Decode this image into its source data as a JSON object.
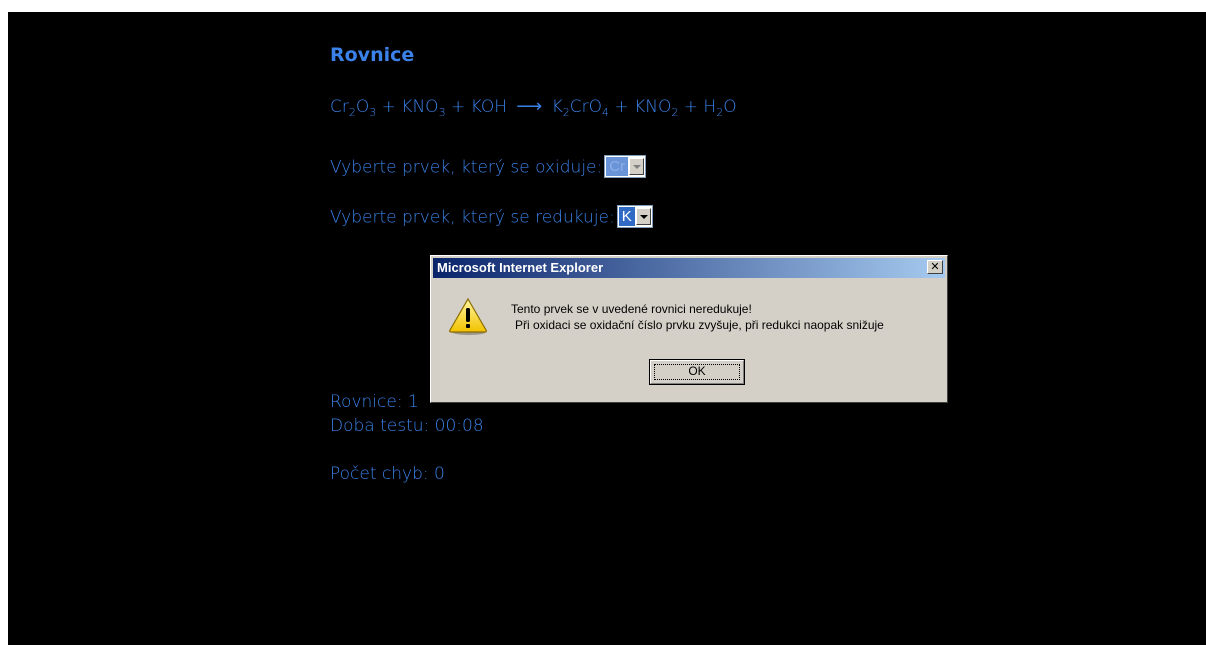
{
  "quiz": {
    "title": "Rovnice",
    "equation": {
      "arrow": "⟶"
    },
    "question_oxidizes": "Vyberte prvek, který se oxiduje:",
    "question_reduces": "Vyberte prvek, který se redukuje:",
    "oxidizes_selected": "Cr",
    "reduces_selected": "K",
    "equation_counter": "Rovnice: 1",
    "test_duration": "Doba testu: 00:08",
    "error_count": "Počet chyb: 0"
  },
  "dialog": {
    "title": "Microsoft Internet Explorer",
    "close_symbol": "✕",
    "message_line1": "Tento prvek se v uvedené rovnici neredukuje!",
    "message_line2": "Při oxidaci se oxidační číslo prvku zvyšuje, při redukci naopak snižuje",
    "ok_label": "OK",
    "icon": "warning-icon"
  },
  "colors": {
    "background": "#000000",
    "text": "#3a82e8",
    "dialog_face": "#d4d0c8",
    "titlebar_start": "#0a246a",
    "titlebar_end": "#a6caf0"
  }
}
